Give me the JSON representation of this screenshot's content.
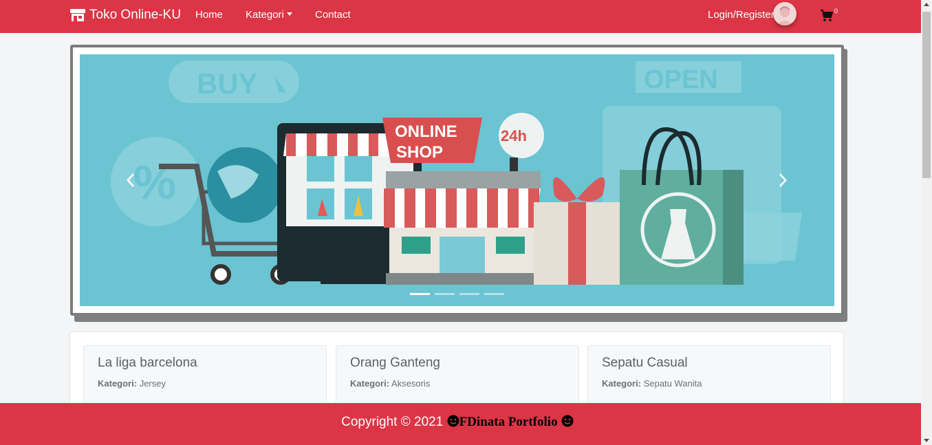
{
  "navbar": {
    "brand": "Toko Online-KU",
    "brand_icon": "store-icon",
    "links": {
      "home": "Home",
      "kategori": "Kategori",
      "contact": "Contact"
    },
    "login": "Login/Register",
    "cart_count": "0",
    "background_color": "#dc3545"
  },
  "carousel": {
    "slide_count": 4,
    "active_index": 0,
    "slide_texts": {
      "buy": "BUY",
      "open": "OPEN",
      "online": "ONLINE",
      "shop": "SHOP",
      "hours": "24h"
    }
  },
  "products": [
    {
      "title": "La liga barcelona",
      "category_label": "Kategori:",
      "category": "Jersey"
    },
    {
      "title": "Orang Ganteng",
      "category_label": "Kategori:",
      "category": "Aksesoris"
    },
    {
      "title": "Sepatu Casual",
      "category_label": "Kategori:",
      "category": "Sepatu Wanita"
    }
  ],
  "footer": {
    "copyright": "Copyright © 2021",
    "author": "FDinata Portfolio"
  }
}
